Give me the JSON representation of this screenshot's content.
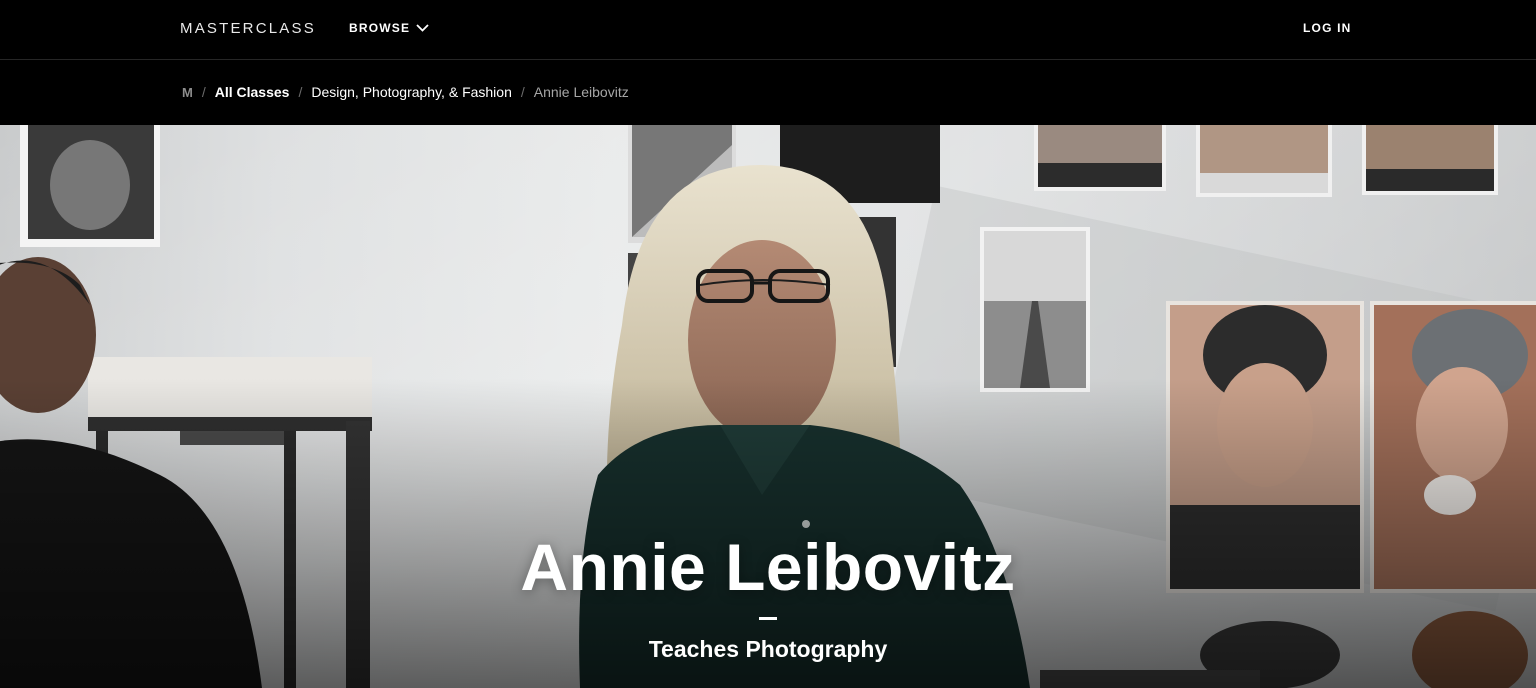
{
  "nav": {
    "logo": "MASTERCLASS",
    "browse_label": "BROWSE",
    "login_label": "LOG IN"
  },
  "breadcrumb": {
    "home": "M",
    "items": [
      "All Classes",
      "Design, Photography, & Fashion",
      "Annie Leibovitz"
    ]
  },
  "hero": {
    "title": "Annie Leibovitz",
    "subtitle": "Teaches Photography"
  },
  "colors": {
    "background": "#000000",
    "text": "#ffffff",
    "breadcrumb_current": "#a6a6a6"
  }
}
